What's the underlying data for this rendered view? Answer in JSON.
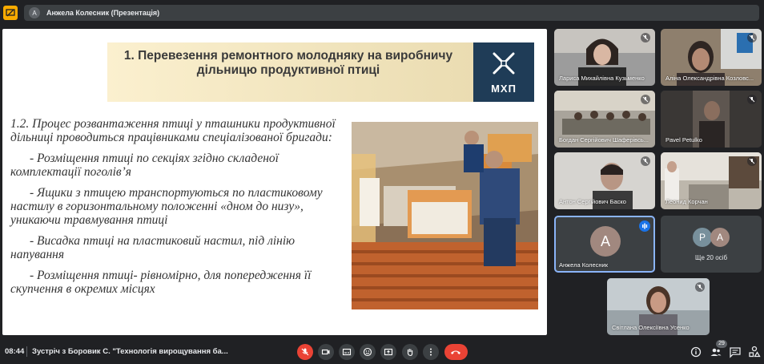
{
  "topbar": {
    "app_icon": "present-to-all-icon",
    "presenter_initial": "А",
    "presenter_label": "Анжела Колесник (Презентація)"
  },
  "slide": {
    "title": "1. Перевезення ремонтного молодняку на виробничу дільницю продуктивної птиці",
    "logo_text": "МХП",
    "paragraphs": [
      "1.2. Процес розвантаження птиці у пташники продуктивної дільниці проводиться працівниками спеціалізованої бригади:",
      "- Розміщення птиці по секціях згідно складеної комплектації поголів’я",
      "- Ящики з птицею транспортуються по пластиковому настилу в горизонтальному положенні «дном до низу», уникаючи травмування птиці",
      "- Висадка птиці на пластиковий настил, під лінію напування",
      "- Розміщення птиці- рівномірно, для попередження її скупчення  в окремих місцях"
    ]
  },
  "participants": [
    {
      "name": "Лариса Михайлівна Кузьменко",
      "muted": true
    },
    {
      "name": "Аліна Олександрівна Козловс...",
      "muted": true
    },
    {
      "name": "Богдан Сергійович Шаферівсь...",
      "muted": true
    },
    {
      "name": "Pavel Petulko",
      "muted": true
    },
    {
      "name": "Антон Сергійович Баско",
      "muted": true
    },
    {
      "name": "Леонид Корчан",
      "muted": true
    },
    {
      "name": "Анжела Колесник",
      "initial": "А",
      "speaking": true
    },
    {
      "name": "Світлана Олексіївна Усенко",
      "muted": true
    }
  ],
  "more_tile": {
    "initials": [
      "Р",
      "А"
    ],
    "label": "Ще 20 осіб"
  },
  "bottombar": {
    "time": "08:44",
    "meeting_title": "Зустріч з Боровик С. \"Технологія вирощування ба...",
    "controls": [
      "mic-off-icon",
      "camera-icon",
      "captions-icon",
      "emoji-icon",
      "present-icon",
      "raise-hand-icon",
      "more-options-icon",
      "end-call-icon"
    ],
    "people_count": "29",
    "right_icons": [
      "info-icon",
      "people-icon",
      "chat-icon",
      "activities-icon"
    ]
  },
  "colors": {
    "background": "#202124",
    "accent_blue": "#8ab4f8",
    "end_call_red": "#ea4335",
    "logo_navy": "#1f3c57"
  }
}
